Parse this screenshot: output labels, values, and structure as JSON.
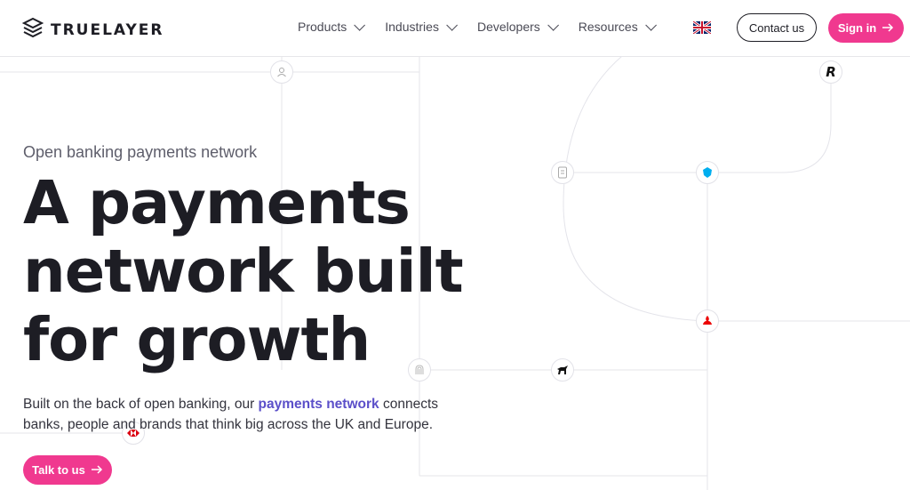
{
  "header": {
    "brand": "TRUELAYER",
    "nav": [
      "Products",
      "Industries",
      "Developers",
      "Resources"
    ],
    "contact_label": "Contact us",
    "signin_label": "Sign in"
  },
  "hero": {
    "eyebrow": "Open banking payments network",
    "headline_1": "A payments",
    "headline_2": "network built",
    "headline_3": "for growth",
    "sub_1": "Built on the back of open banking, our ",
    "sub_link": "payments network",
    "sub_2": " connects banks, people and brands that think big across the UK and Europe.",
    "cta_label": "Talk to us"
  },
  "colors": {
    "accent": "#f0398f",
    "link": "#5b4fc9",
    "text": "#1d1d24"
  },
  "icons": [
    "truelayer-logo-icon",
    "chevron-down-icon",
    "uk-flag-icon",
    "arrow-right-icon",
    "user-icon",
    "revolut-icon",
    "document-icon",
    "barclays-icon",
    "santander-icon",
    "lloyds-icon",
    "fingerprint-icon",
    "hsbc-icon"
  ]
}
